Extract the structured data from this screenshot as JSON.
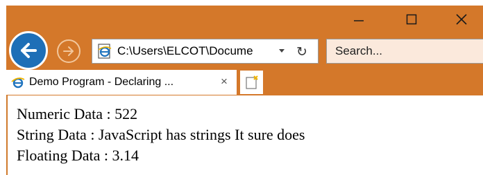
{
  "window": {
    "controls": {
      "minimize": "minimize-icon",
      "maximize": "maximize-icon",
      "close": "close-icon"
    },
    "accent_color": "#d4782a"
  },
  "navigation": {
    "back": "back-arrow-icon",
    "forward": "forward-arrow-icon",
    "address": "C:\\Users\\ELCOT\\Docume",
    "search_placeholder": "Search..."
  },
  "tabs": [
    {
      "title": "Demo Program - Declaring ...",
      "close": "×"
    }
  ],
  "page": {
    "lines": [
      "Numeric Data : 522",
      "String Data : JavaScript has strings It sure does",
      "Floating Data : 3.14"
    ]
  }
}
